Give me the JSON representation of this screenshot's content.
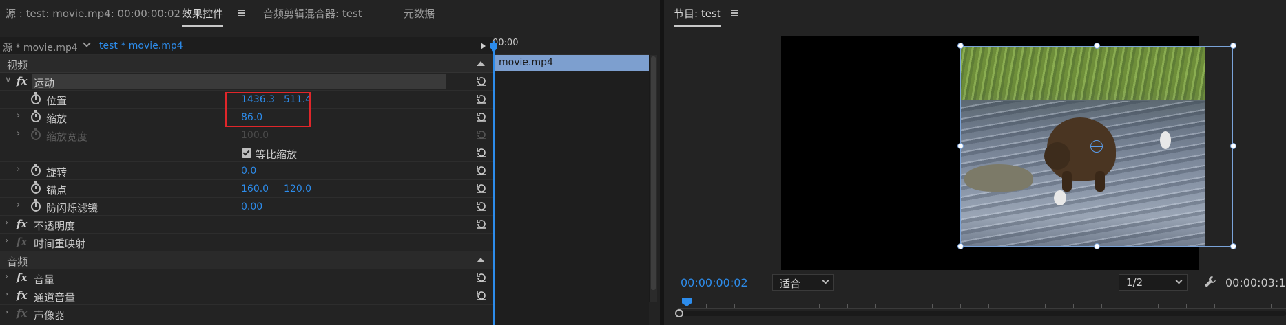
{
  "effect_controls": {
    "tabs": [
      {
        "label": "源 : test: movie.mp4: 00:00:00:02"
      },
      {
        "label": "效果控件"
      },
      {
        "label": "音频剪辑混合器: test"
      },
      {
        "label": "元数据"
      }
    ],
    "source_clip": "源 * movie.mp4",
    "sequence_clip": "test * movie.mp4",
    "timeline": {
      "timecode": "00:00",
      "clip": "movie.mp4"
    },
    "sections": {
      "video": "视频",
      "audio": "音频"
    },
    "effects": {
      "motion": {
        "label": "运动",
        "position": {
          "label": "位置",
          "x": "1436.3",
          "y": "511.4"
        },
        "scale": {
          "label": "缩放",
          "value": "86.0"
        },
        "scale_width": {
          "label": "缩放宽度",
          "value": "100.0"
        },
        "uniform_scale": {
          "label": "等比缩放",
          "checked": true
        },
        "rotation": {
          "label": "旋转",
          "value": "0.0"
        },
        "anchor": {
          "label": "锚点",
          "x": "160.0",
          "y": "120.0"
        },
        "anti_flicker": {
          "label": "防闪烁滤镜",
          "value": "0.00"
        }
      },
      "opacity": {
        "label": "不透明度"
      },
      "time_remap": {
        "label": "时间重映射"
      },
      "volume": {
        "label": "音量"
      },
      "channel_volume": {
        "label": "通道音量"
      },
      "panner": {
        "label": "声像器"
      }
    }
  },
  "program_monitor": {
    "title": "节目: test",
    "current_time": "00:00:00:02",
    "fit": "适合",
    "resolution": "1/2",
    "duration": "00:00:03:1"
  },
  "colors": {
    "accent": "#2d8ceb",
    "highlight_box": "#e0262a",
    "timeline_clip": "#7d9fcf"
  }
}
